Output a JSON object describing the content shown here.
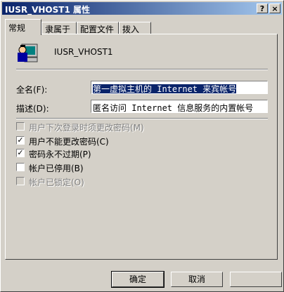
{
  "window": {
    "title": "IUSR_VHOST1 属性",
    "help_btn": "?",
    "close_btn": "×"
  },
  "tabs": [
    {
      "label": "常规",
      "active": true
    },
    {
      "label": "隶属于",
      "active": false
    },
    {
      "label": "配置文件",
      "active": false
    },
    {
      "label": "拨入",
      "active": false
    }
  ],
  "user": {
    "name": "IUSR_VHOST1"
  },
  "fields": {
    "fullname": {
      "label": "全名(F):",
      "value": "第一虚拟主机的 Internet 来宾帐号"
    },
    "description": {
      "label": "描述(D):",
      "value": "匿名访问 Internet 信息服务的内置帐号"
    }
  },
  "checkboxes": [
    {
      "label": "用户下次登录时须更改密码(M)",
      "checked": false,
      "disabled": true
    },
    {
      "label": "用户不能更改密码(C)",
      "checked": true,
      "disabled": false
    },
    {
      "label": "密码永不过期(P)",
      "checked": true,
      "disabled": false
    },
    {
      "label": "帐户已停用(B)",
      "checked": false,
      "disabled": false
    },
    {
      "label": "帐户已锁定(O)",
      "checked": false,
      "disabled": true
    }
  ],
  "buttons": {
    "ok": "确定",
    "cancel": "取消"
  }
}
